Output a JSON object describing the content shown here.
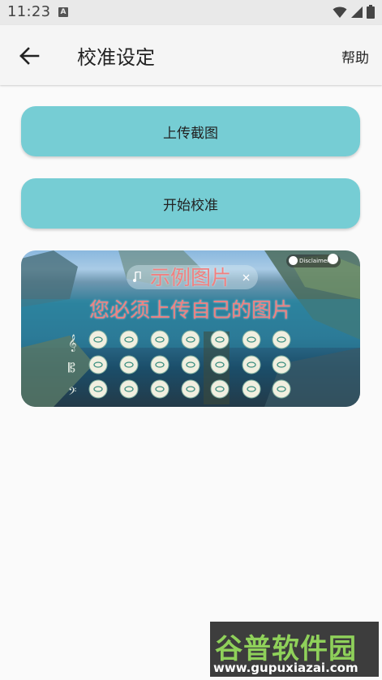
{
  "status_bar": {
    "time": "11:23",
    "badge": "A"
  },
  "app_bar": {
    "title": "校准设定",
    "help_label": "帮助",
    "back_icon": "arrow-left-icon"
  },
  "actions": {
    "upload_label": "上传截图",
    "calibrate_label": "开始校准"
  },
  "sample_image": {
    "line1": "示例图片",
    "line2": "您必须上传自己的图片",
    "disclaimer": "Disclaimer"
  },
  "watermark": {
    "brand": "谷普软件园",
    "url": "www.gupuxiazai.com"
  },
  "colors": {
    "button": "#76cdd4",
    "overlay_text": "#f08080"
  }
}
